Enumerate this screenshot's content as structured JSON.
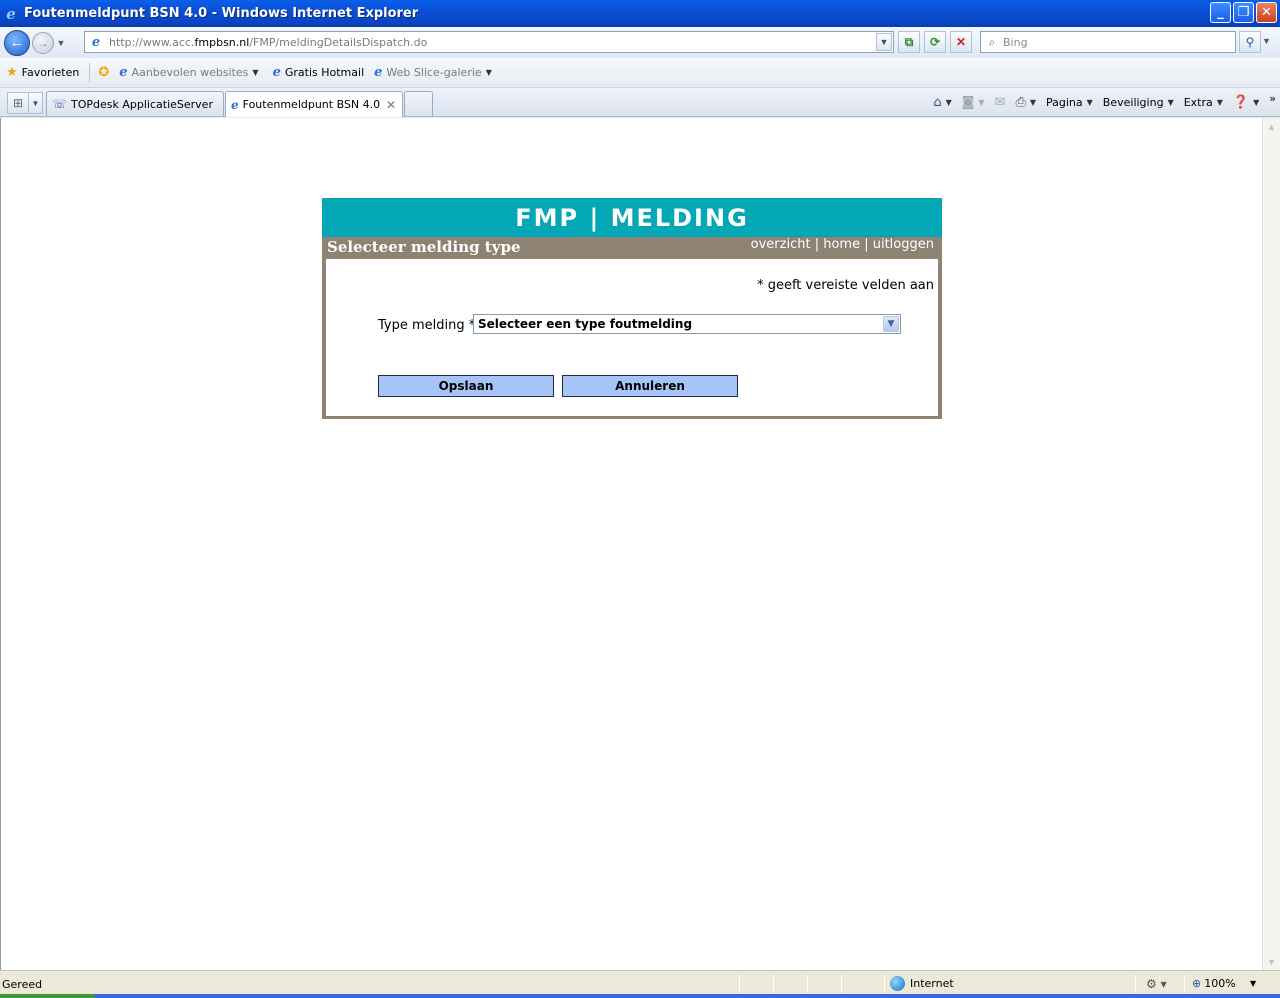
{
  "window": {
    "title": "Foutenmeldpunt BSN 4.0 - Windows Internet Explorer",
    "minimize": "_",
    "restore": "❐",
    "close": "✕"
  },
  "navigation": {
    "url_prefix": "http://www.acc.",
    "url_domain": "fmpbsn.nl",
    "url_path": "/FMP/meldingDetailsDispatch.do",
    "search_placeholder": "Bing"
  },
  "favorites": {
    "favorites_label": "Favorieten",
    "items": [
      {
        "label": "Aanbevolen websites"
      },
      {
        "label": "Gratis Hotmail"
      },
      {
        "label": "Web Slice-galerie"
      }
    ]
  },
  "tabs": [
    {
      "label": "TOPdesk ApplicatieServer"
    },
    {
      "label": "Foutenmeldpunt BSN 4.0"
    }
  ],
  "commandbar": {
    "page": "Pagina",
    "security": "Beveiliging",
    "tools": "Extra",
    "more": "»"
  },
  "panel": {
    "header": "FMP | MELDING",
    "subtitle": "Selecteer melding type",
    "links": {
      "overview": "overzicht",
      "sep1": " | ",
      "home": "home",
      "sep2": " | ",
      "logout": "uitloggen"
    },
    "required_note": "* geeft vereiste velden aan",
    "field_label": "Type melding *",
    "select_value": "Selecteer een type foutmelding",
    "save_label": "Opslaan",
    "cancel_label": "Annuleren"
  },
  "status": {
    "text": "Gereed",
    "zone": "Internet",
    "zoom": "100%"
  },
  "colors": {
    "header_teal": "#03a7b5",
    "panel_taupe": "#8e8273",
    "button_blue": "#a6c4f6"
  }
}
